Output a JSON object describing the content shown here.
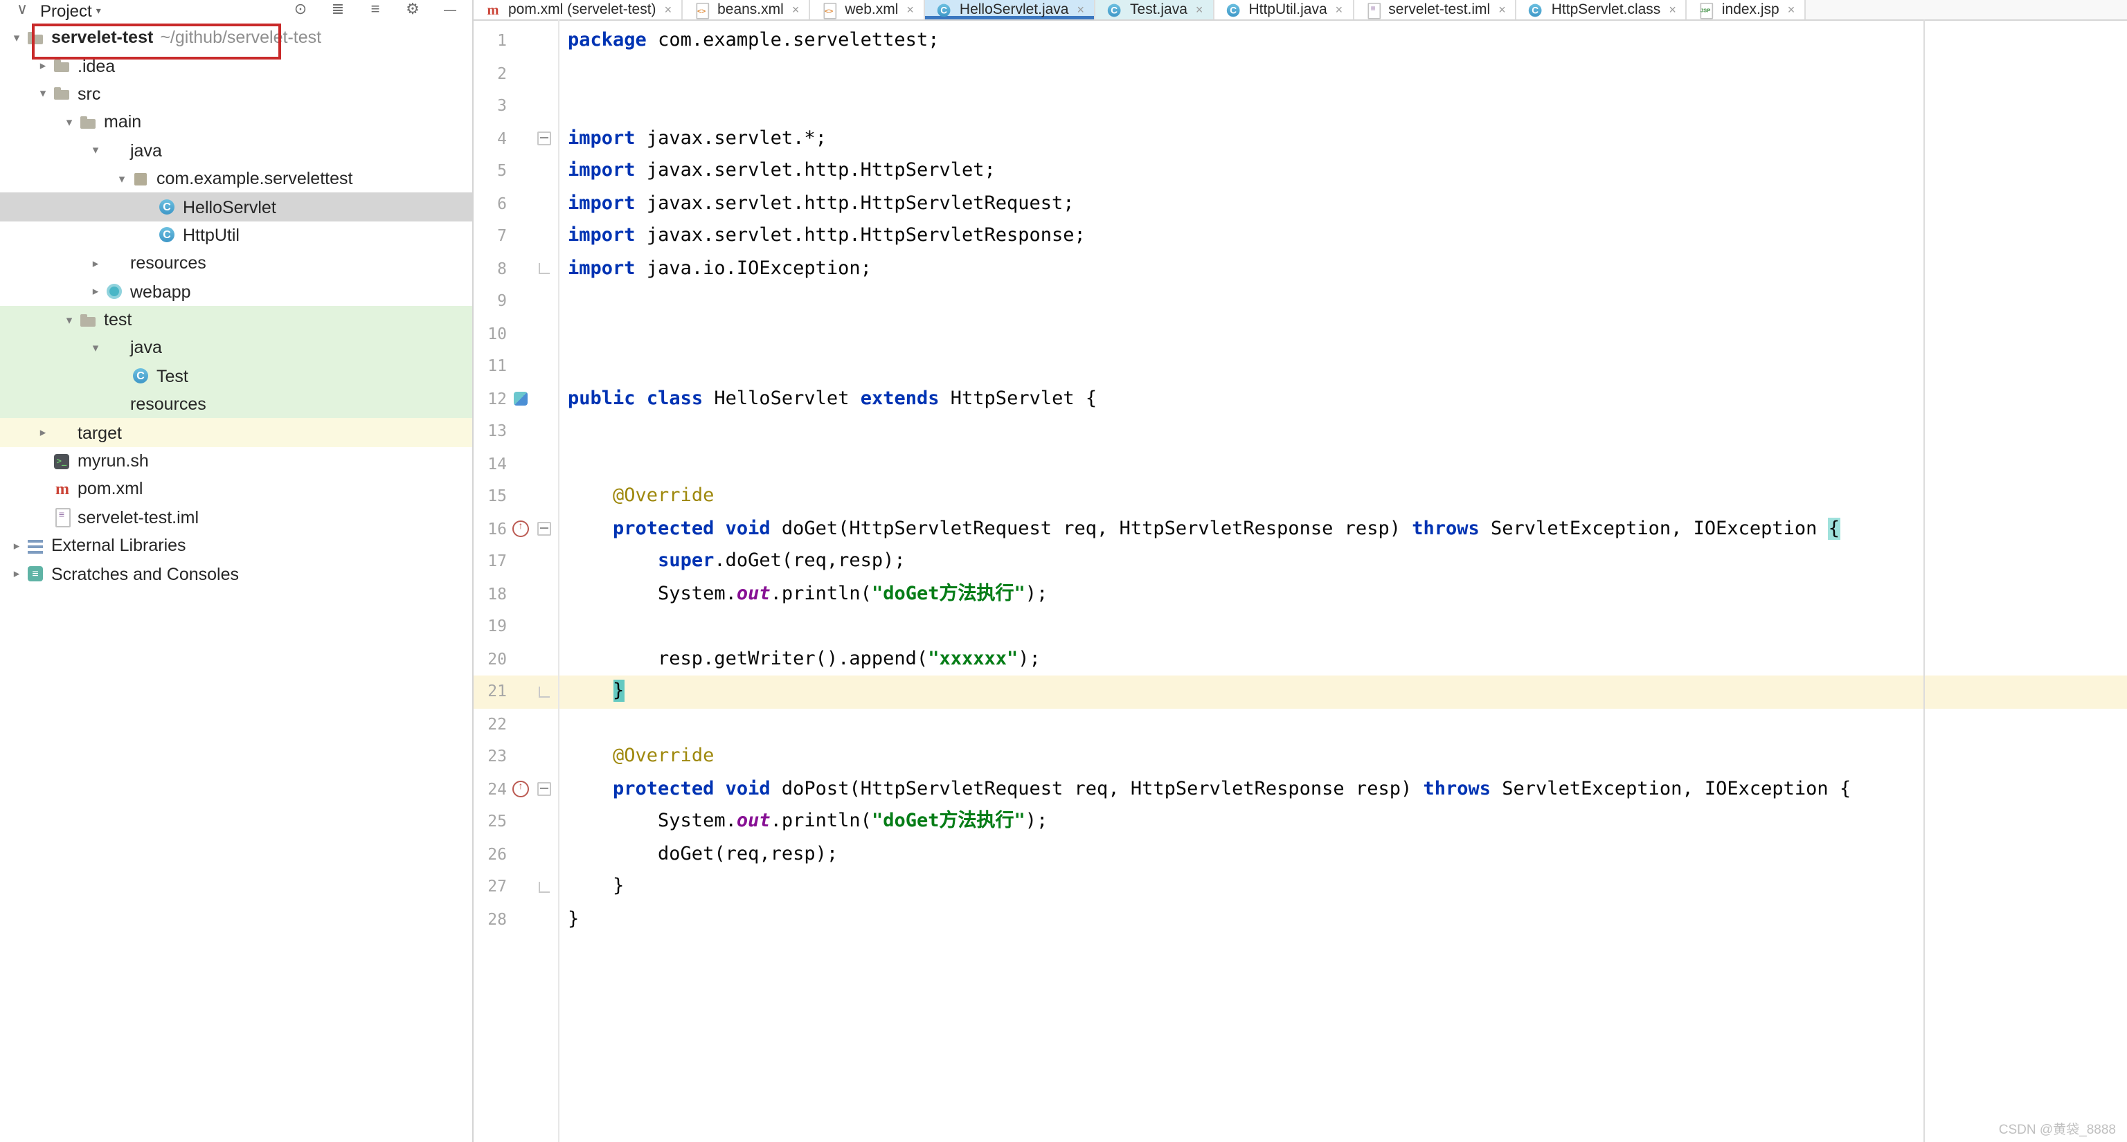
{
  "colors": {
    "keyword": "#0033b3",
    "string": "#067d17",
    "annotation": "#9e880d",
    "field": "#871094",
    "current_line": "#fcf5da",
    "selection_gray": "#d5d5d5",
    "vcs_green_bg": "#e2f3dd",
    "excluded_yellow_bg": "#fbf9e0",
    "active_tab_bg": "#cfe7f8",
    "active_tab_underline": "#3b77c0",
    "tinted_tab_bg": "#dcf0f3",
    "annotation_box_red": "#c92a2a",
    "brace_match_bg": "#9fe1dc",
    "brace_match_bg2": "#63c9c1"
  },
  "project_panel": {
    "header": {
      "title": "Project",
      "icons": [
        "locate-icon",
        "expand-all-icon",
        "collapse-all-icon",
        "settings-icon",
        "hide-icon"
      ]
    },
    "tree": [
      {
        "label": "servelet-test",
        "path": "~/github/servelet-test",
        "level": 0,
        "chevron": "down",
        "icon": "folder",
        "bold": true,
        "annotated": true
      },
      {
        "label": ".idea",
        "level": 1,
        "chevron": "right",
        "icon": "folder"
      },
      {
        "label": "src",
        "level": 1,
        "chevron": "down",
        "icon": "folder"
      },
      {
        "label": "main",
        "level": 2,
        "chevron": "down",
        "icon": "folder"
      },
      {
        "label": "java",
        "level": 3,
        "chevron": "down",
        "icon": "folder-source"
      },
      {
        "label": "com.example.servelettest",
        "level": 4,
        "chevron": "down",
        "icon": "package"
      },
      {
        "label": "HelloServlet",
        "level": 5,
        "icon": "class",
        "selected": true
      },
      {
        "label": "HttpUtil",
        "level": 5,
        "icon": "class"
      },
      {
        "label": "resources",
        "level": 3,
        "chevron": "right",
        "icon": "folder-resources"
      },
      {
        "label": "webapp",
        "level": 3,
        "chevron": "right",
        "icon": "web"
      },
      {
        "label": "test",
        "level": 2,
        "chevron": "down",
        "icon": "folder",
        "vcs": "green"
      },
      {
        "label": "java",
        "level": 3,
        "chevron": "down",
        "icon": "folder-test",
        "vcs": "green"
      },
      {
        "label": "Test",
        "level": 4,
        "icon": "class",
        "vcs": "green"
      },
      {
        "label": "resources",
        "level": 3,
        "icon": "folder-test-resources",
        "vcs": "green"
      },
      {
        "label": "target",
        "level": 1,
        "chevron": "right",
        "icon": "folder-excluded",
        "vcs": "yellow"
      },
      {
        "label": "myrun.sh",
        "level": 1,
        "icon": "shell"
      },
      {
        "label": "pom.xml",
        "level": 1,
        "icon": "maven"
      },
      {
        "label": "servelet-test.iml",
        "level": 1,
        "icon": "iml"
      },
      {
        "label": "External Libraries",
        "level": 0,
        "chevron": "right",
        "icon": "libraries"
      },
      {
        "label": "Scratches and Consoles",
        "level": 0,
        "chevron": "right",
        "icon": "scratches"
      }
    ]
  },
  "tabs": [
    {
      "label": "pom.xml (servelet-test)",
      "icon": "maven"
    },
    {
      "label": "beans.xml",
      "icon": "xml"
    },
    {
      "label": "web.xml",
      "icon": "xml"
    },
    {
      "label": "HelloServlet.java",
      "icon": "class",
      "active": true
    },
    {
      "label": "Test.java",
      "icon": "class",
      "tinted": true
    },
    {
      "label": "HttpUtil.java",
      "icon": "class"
    },
    {
      "label": "servelet-test.iml",
      "icon": "iml"
    },
    {
      "label": "HttpServlet.class",
      "icon": "class"
    },
    {
      "label": "index.jsp",
      "icon": "jsp"
    }
  ],
  "editor": {
    "current_line": 21,
    "lines": [
      {
        "n": 1,
        "tokens": [
          {
            "c": "kw",
            "t": "package"
          },
          {
            "t": " com.example.servelettest;"
          }
        ]
      },
      {
        "n": 2,
        "tokens": []
      },
      {
        "n": 3,
        "tokens": []
      },
      {
        "n": 4,
        "fold": "start",
        "tokens": [
          {
            "c": "kw",
            "t": "import"
          },
          {
            "t": " javax.servlet.*;"
          }
        ]
      },
      {
        "n": 5,
        "tokens": [
          {
            "c": "kw",
            "t": "import"
          },
          {
            "t": " javax.servlet.http.HttpServlet;"
          }
        ]
      },
      {
        "n": 6,
        "tokens": [
          {
            "c": "kw",
            "t": "import"
          },
          {
            "t": " javax.servlet.http.HttpServletRequest;"
          }
        ]
      },
      {
        "n": 7,
        "tokens": [
          {
            "c": "kw",
            "t": "import"
          },
          {
            "t": " javax.servlet.http.HttpServletResponse;"
          }
        ]
      },
      {
        "n": 8,
        "fold": "end",
        "tokens": [
          {
            "c": "kw",
            "t": "import"
          },
          {
            "t": " java.io.IOException;"
          }
        ]
      },
      {
        "n": 9,
        "tokens": []
      },
      {
        "n": 10,
        "tokens": []
      },
      {
        "n": 11,
        "tokens": []
      },
      {
        "n": 12,
        "gicon": "run",
        "tokens": [
          {
            "c": "kw",
            "t": "public"
          },
          {
            "t": " "
          },
          {
            "c": "kw",
            "t": "class"
          },
          {
            "t": " HelloServlet "
          },
          {
            "c": "kw",
            "t": "extends"
          },
          {
            "t": " HttpServlet {"
          }
        ]
      },
      {
        "n": 13,
        "tokens": []
      },
      {
        "n": 14,
        "tokens": []
      },
      {
        "n": 15,
        "tokens": [
          {
            "t": "    "
          },
          {
            "c": "ann",
            "t": "@Override"
          }
        ]
      },
      {
        "n": 16,
        "gicon": "override",
        "fold": "start",
        "tokens": [
          {
            "t": "    "
          },
          {
            "c": "kw",
            "t": "protected"
          },
          {
            "t": " "
          },
          {
            "c": "kw",
            "t": "void"
          },
          {
            "t": " doGet(HttpServletRequest req, HttpServletResponse resp) "
          },
          {
            "c": "kw",
            "t": "throws"
          },
          {
            "t": " ServletException, IOException "
          },
          {
            "c": "brace",
            "t": "{"
          }
        ]
      },
      {
        "n": 17,
        "tokens": [
          {
            "t": "        "
          },
          {
            "c": "kw",
            "t": "super"
          },
          {
            "t": ".doGet(req,resp);"
          }
        ]
      },
      {
        "n": 18,
        "tokens": [
          {
            "t": "        System."
          },
          {
            "c": "field",
            "t": "out"
          },
          {
            "t": ".println("
          },
          {
            "c": "str",
            "t": "\"doGet方法执行\""
          },
          {
            "t": ");"
          }
        ]
      },
      {
        "n": 19,
        "tokens": []
      },
      {
        "n": 20,
        "tokens": [
          {
            "t": "        resp.getWriter().append("
          },
          {
            "c": "str",
            "t": "\"xxxxxx\""
          },
          {
            "t": ");"
          }
        ]
      },
      {
        "n": 21,
        "fold": "end",
        "tokens": [
          {
            "t": "    "
          },
          {
            "c": "brace2",
            "t": "}"
          }
        ]
      },
      {
        "n": 22,
        "tokens": []
      },
      {
        "n": 23,
        "tokens": [
          {
            "t": "    "
          },
          {
            "c": "ann",
            "t": "@Override"
          }
        ]
      },
      {
        "n": 24,
        "gicon": "override",
        "fold": "start",
        "tokens": [
          {
            "t": "    "
          },
          {
            "c": "kw",
            "t": "protected"
          },
          {
            "t": " "
          },
          {
            "c": "kw",
            "t": "void"
          },
          {
            "t": " doPost(HttpServletRequest req, HttpServletResponse resp) "
          },
          {
            "c": "kw",
            "t": "throws"
          },
          {
            "t": " ServletException, IOException {"
          }
        ]
      },
      {
        "n": 25,
        "tokens": [
          {
            "t": "        System."
          },
          {
            "c": "field",
            "t": "out"
          },
          {
            "t": ".println("
          },
          {
            "c": "str",
            "t": "\"doGet方法执行\""
          },
          {
            "t": ");"
          }
        ]
      },
      {
        "n": 26,
        "tokens": [
          {
            "t": "        doGet(req,resp);"
          }
        ]
      },
      {
        "n": 27,
        "fold": "end",
        "tokens": [
          {
            "t": "    }"
          }
        ]
      },
      {
        "n": 28,
        "tokens": [
          {
            "t": "}"
          }
        ]
      }
    ]
  },
  "watermark": "CSDN @黄袋_8888"
}
